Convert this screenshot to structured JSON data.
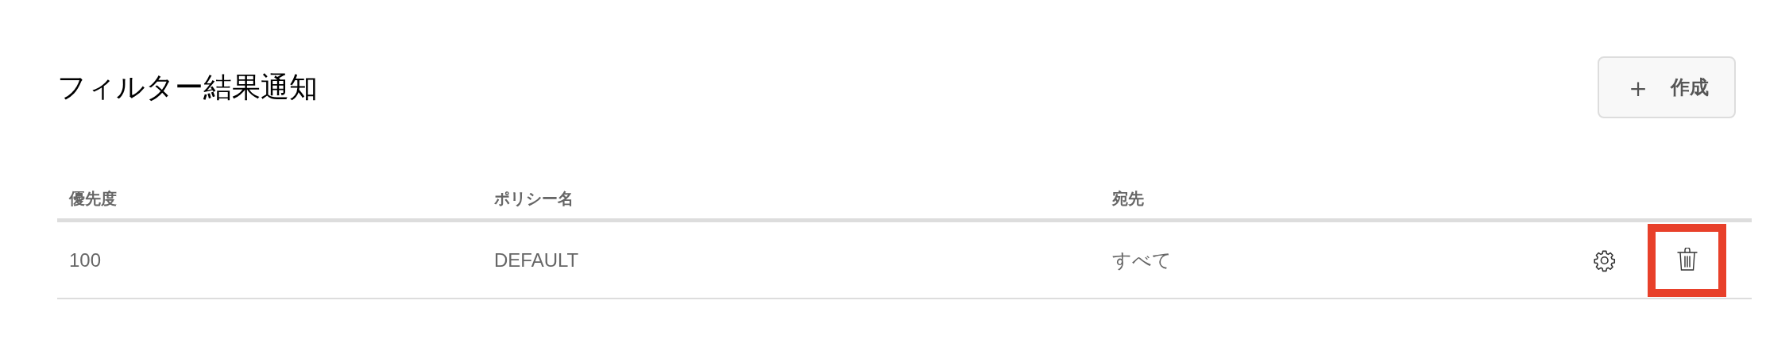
{
  "title": "フィルター結果通知",
  "create_button": {
    "icon": "＋",
    "label": "作成"
  },
  "table": {
    "columns": [
      "優先度",
      "ポリシー名",
      "宛先"
    ],
    "rows": [
      {
        "cells": [
          "100",
          "DEFAULT",
          "すべて"
        ],
        "delete_highlighted": true
      }
    ]
  }
}
